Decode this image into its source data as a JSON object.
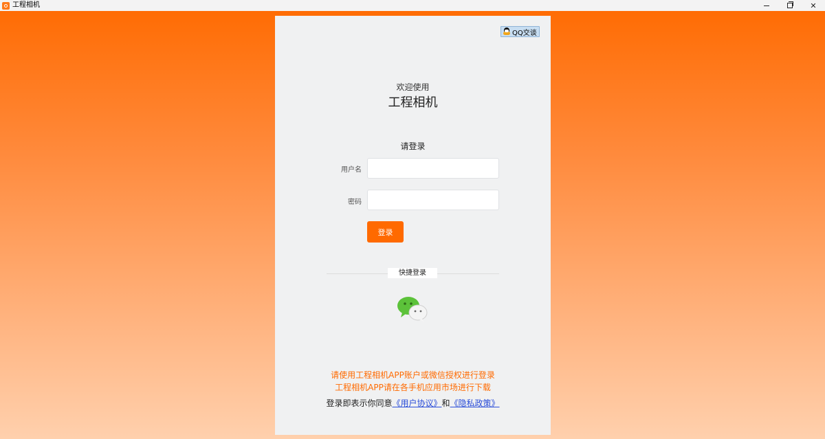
{
  "window": {
    "title": "工程相机",
    "icon": "app-logo-icon",
    "controls": [
      "minimize-icon",
      "restore-icon",
      "close-icon"
    ],
    "close_glyph": "✕"
  },
  "card": {
    "qq_button_label": "QQ交谈",
    "welcome": "欢迎使用",
    "app_name": "工程相机",
    "login_heading": "请登录",
    "username_label": "用户名",
    "username_value": "",
    "username_placeholder": "",
    "password_label": "密码",
    "password_value": "",
    "password_placeholder": "",
    "login_button": "登录",
    "quick_login_label": "快捷登录",
    "wechat_icon": "wechat-icon",
    "notice_line1": "请使用工程相机APP账户或微信授权进行登录",
    "notice_line2": "工程相机APP请在各手机应用市场进行下载",
    "agree_prefix": "登录即表示你同意",
    "user_agreement": "《用户协议》",
    "and_text": "和",
    "privacy_policy": "《隐私政策》"
  },
  "colors": {
    "brand_orange": "#ff6a00",
    "card_background": "#f0f1f2",
    "link_blue": "#2a4dd8",
    "wechat_green": "#5cc23a"
  }
}
